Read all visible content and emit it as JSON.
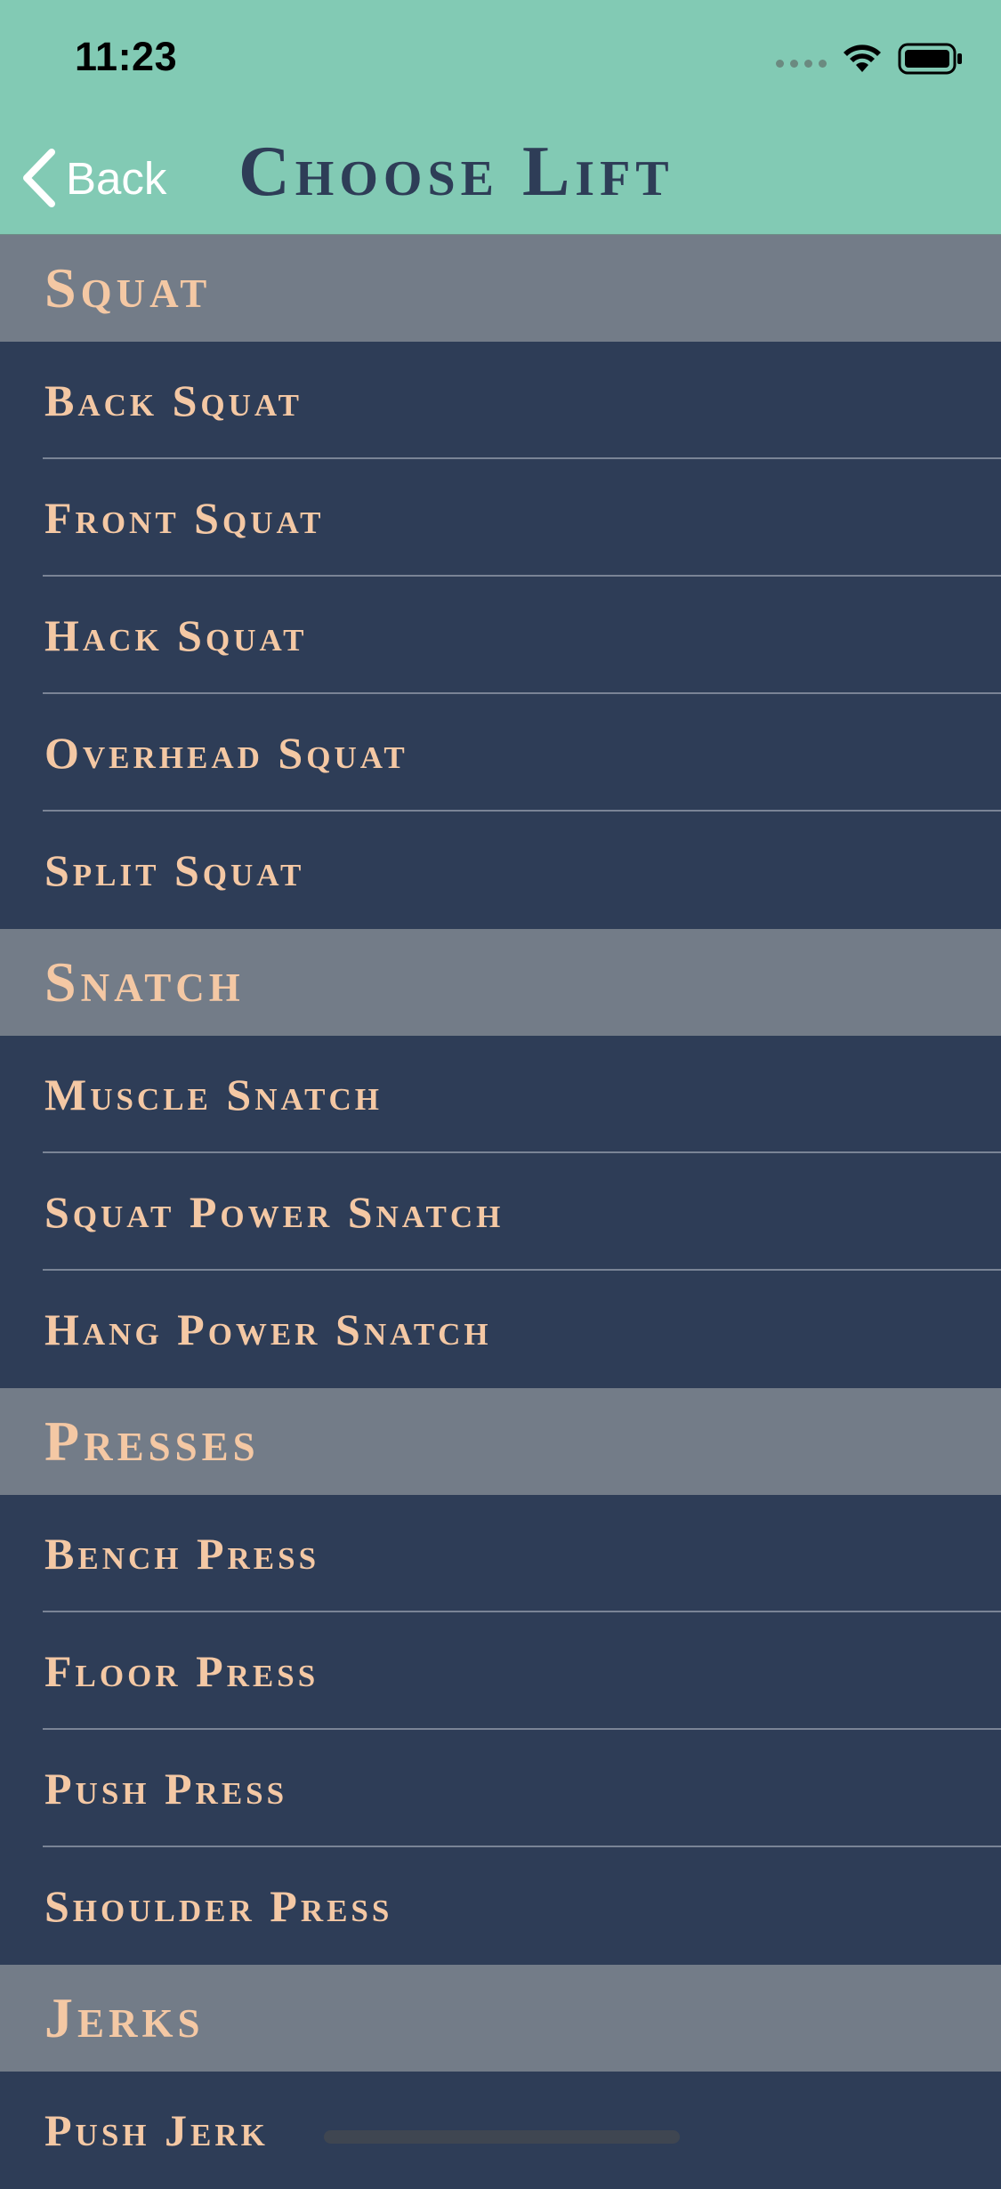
{
  "status_bar": {
    "time": "11:23"
  },
  "nav": {
    "back_label": "Back",
    "title": "Choose Lift"
  },
  "colors": {
    "header_bg": "#82cab4",
    "list_bg": "#2e3d57",
    "section_bg": "#737c88",
    "text_accent": "#f4c8a4"
  },
  "sections": [
    {
      "title": "Squat",
      "items": [
        "Back Squat",
        "Front Squat",
        "Hack Squat",
        "Overhead Squat",
        "Split Squat"
      ]
    },
    {
      "title": "Snatch",
      "items": [
        "Muscle Snatch",
        "Squat Power Snatch",
        "Hang Power Snatch"
      ]
    },
    {
      "title": "Presses",
      "items": [
        "Bench Press",
        "Floor Press",
        "Push Press",
        "Shoulder Press"
      ]
    },
    {
      "title": "Jerks",
      "items": [
        "Push Jerk"
      ]
    }
  ]
}
